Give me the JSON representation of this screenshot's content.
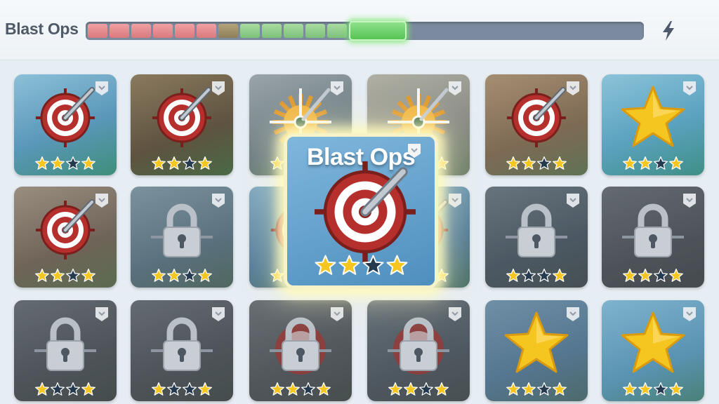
{
  "header": {
    "title": "Blast Ops",
    "progress": {
      "red_segments": 6,
      "neutral_segments": 1,
      "green_segments": 5,
      "current_index": 12,
      "fraction": 0.57
    },
    "energy_icon": "lightning-bolt-icon"
  },
  "colors": {
    "star_filled": "#f5c520",
    "star_empty": "#253a4f",
    "target_red": "#b5302c",
    "lock_gray": "#c9ced4",
    "highlight_glow": "#fffabf"
  },
  "popup": {
    "title": "Blast Ops",
    "stars": [
      true,
      true,
      false,
      true
    ]
  },
  "levels": [
    {
      "id": "r1c1",
      "icon": "target-icon",
      "locked": false,
      "stars": [
        true,
        true,
        false,
        true
      ]
    },
    {
      "id": "r1c2",
      "icon": "target-icon",
      "locked": false,
      "stars": [
        true,
        true,
        false,
        true
      ]
    },
    {
      "id": "r1c3",
      "icon": "sun-crosshair-icon",
      "locked": false,
      "stars": [
        true,
        true,
        false,
        true
      ]
    },
    {
      "id": "r1c4",
      "icon": "sun-crosshair-icon",
      "locked": false,
      "stars": [
        true,
        true,
        false,
        true
      ]
    },
    {
      "id": "r1c5",
      "icon": "target-icon",
      "locked": false,
      "stars": [
        true,
        true,
        false,
        true
      ]
    },
    {
      "id": "r1c6",
      "icon": "star-icon",
      "locked": false,
      "stars": [
        true,
        true,
        false,
        true
      ]
    },
    {
      "id": "r2c1",
      "icon": "target-icon",
      "locked": false,
      "stars": [
        true,
        true,
        false,
        true
      ]
    },
    {
      "id": "r2c2",
      "icon": "lock-icon",
      "locked": true,
      "stars": [
        true,
        true,
        false,
        true
      ]
    },
    {
      "id": "r2c3",
      "icon": "target-icon",
      "locked": false,
      "stars": [
        true,
        true,
        false,
        true
      ]
    },
    {
      "id": "r2c4",
      "icon": "target-icon",
      "locked": false,
      "stars": [
        true,
        true,
        false,
        true
      ]
    },
    {
      "id": "r2c5",
      "icon": "lock-icon",
      "locked": true,
      "stars": [
        true,
        false,
        false,
        true
      ]
    },
    {
      "id": "r2c6",
      "icon": "lock-icon",
      "locked": true,
      "stars": [
        true,
        true,
        false,
        true
      ]
    },
    {
      "id": "r3c1",
      "icon": "lock-icon",
      "locked": true,
      "stars": [
        true,
        false,
        false,
        true
      ]
    },
    {
      "id": "r3c2",
      "icon": "lock-icon",
      "locked": true,
      "stars": [
        true,
        false,
        false,
        true
      ]
    },
    {
      "id": "r3c3",
      "icon": "lock-target-icon",
      "locked": true,
      "stars": [
        true,
        true,
        false,
        true
      ]
    },
    {
      "id": "r3c4",
      "icon": "lock-target-icon",
      "locked": true,
      "stars": [
        true,
        true,
        false,
        true
      ]
    },
    {
      "id": "r3c5",
      "icon": "star-icon",
      "locked": false,
      "stars": [
        true,
        true,
        false,
        true
      ]
    },
    {
      "id": "r3c6",
      "icon": "star-icon",
      "locked": false,
      "stars": [
        true,
        true,
        false,
        true
      ]
    }
  ]
}
